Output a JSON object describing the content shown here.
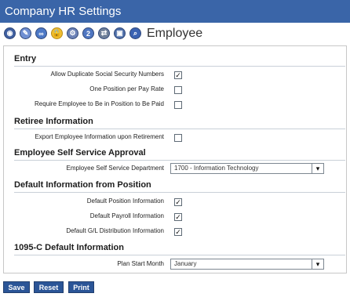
{
  "window": {
    "title": "Company HR Settings"
  },
  "toolbar": {
    "title": "Employee",
    "icons": [
      "employee-icon",
      "employee-edit-icon",
      "link-icon",
      "lock-icon",
      "settings-icon",
      "number-two-icon",
      "transfer-icon",
      "card-icon",
      "search-icon"
    ]
  },
  "sections": {
    "entry": {
      "title": "Entry",
      "allow_duplicate_ssn": {
        "label": "Allow Duplicate Social Security Numbers",
        "checked": true
      },
      "one_position_per_pay_rate": {
        "label": "One Position per Pay Rate",
        "checked": false
      },
      "require_position_to_be_paid": {
        "label": "Require Employee to Be in Position to Be Paid",
        "checked": false
      }
    },
    "retiree": {
      "title": "Retiree Information",
      "export_upon_retirement": {
        "label": "Export Employee Information upon Retirement",
        "checked": false
      }
    },
    "ess_approval": {
      "title": "Employee Self Service Approval",
      "department": {
        "label": "Employee Self Service Department",
        "value": "1700 - Information Technology"
      }
    },
    "default_position": {
      "title": "Default Information from Position",
      "position_info": {
        "label": "Default Position Information",
        "checked": true
      },
      "payroll_info": {
        "label": "Default Payroll Information",
        "checked": true
      },
      "gl_distribution": {
        "label": "Default G/L Distribution Information",
        "checked": true
      }
    },
    "c1095": {
      "title": "1095-C Default Information",
      "plan_start_month": {
        "label": "Plan Start Month",
        "value": "January"
      }
    }
  },
  "buttons": {
    "save": "Save",
    "reset": "Reset",
    "print": "Print"
  },
  "colors": {
    "titlebar_bg": "#3a65a8",
    "button_bg": "#2b5597"
  }
}
